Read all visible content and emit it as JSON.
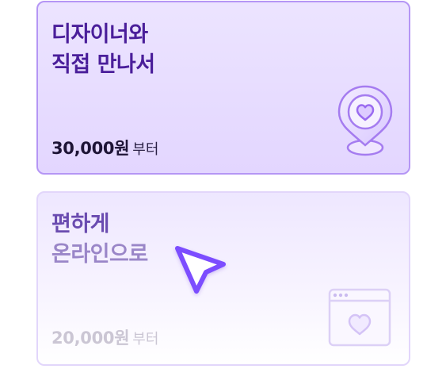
{
  "cards": [
    {
      "title_line1": "디자이너와",
      "title_line2": "직접 만나서",
      "price": "30,000원",
      "price_suffix": "부터",
      "icon": "location-pin-heart-icon"
    },
    {
      "title_line1": "편하게",
      "title_line2": "온라인으로",
      "price": "20,000원",
      "price_suffix": "부터",
      "icon": "browser-heart-icon"
    }
  ],
  "cursor_icon": "pointer-cursor-icon",
  "colors": {
    "accent": "#7c4dff",
    "card1_bg": "#e6dbff",
    "card1_border": "#b596f5",
    "card1_title": "#4a1e9a",
    "card2_title": "#6a4bb0"
  }
}
